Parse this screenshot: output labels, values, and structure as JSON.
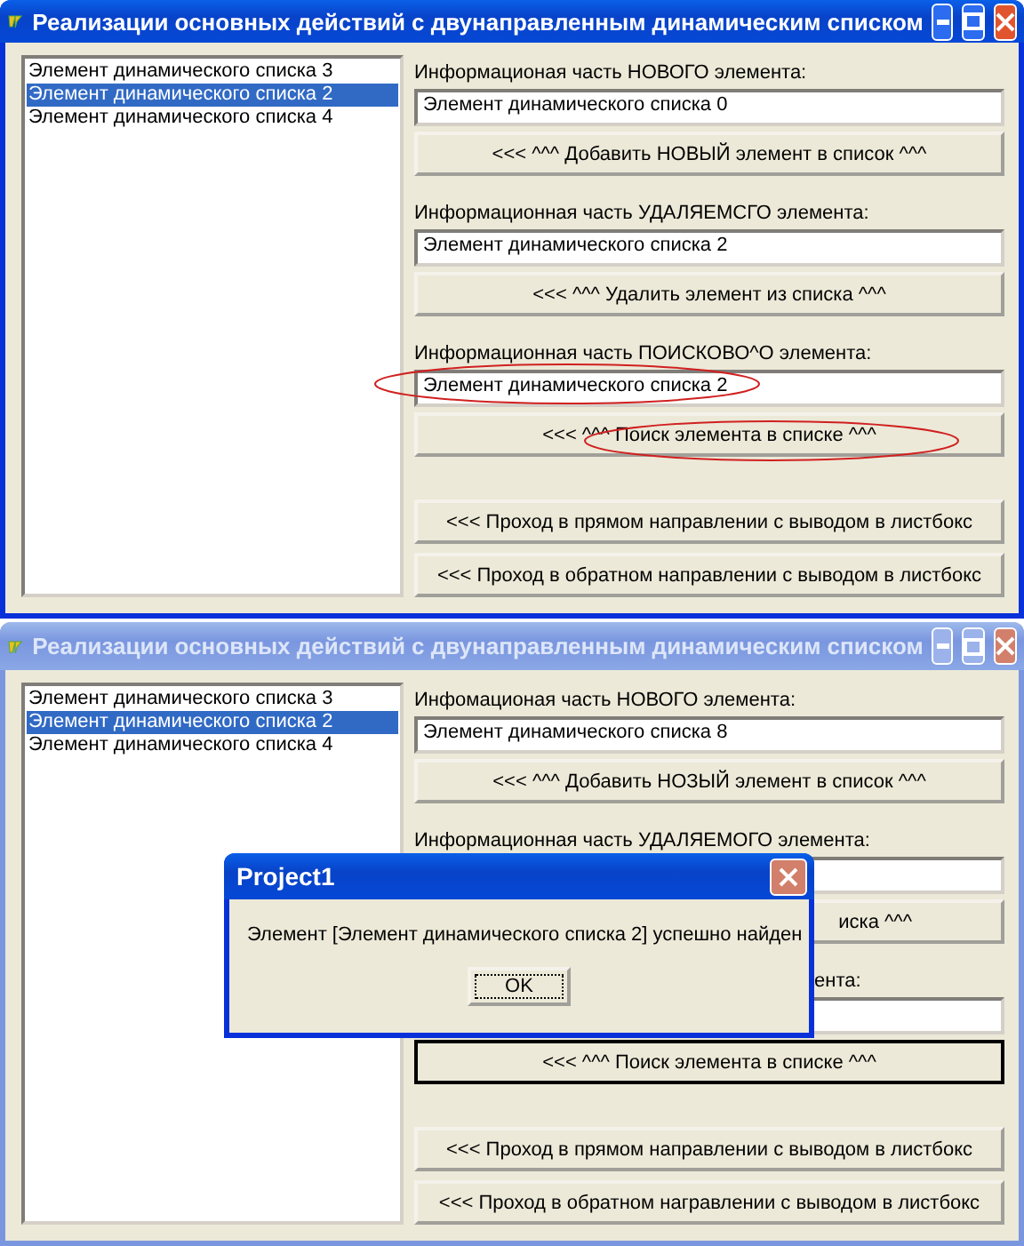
{
  "windows": [
    {
      "title": "Реализации основных действий с двунаправленным динамическим списком",
      "active": true,
      "list": [
        {
          "label": "Элемент динамического списка 3",
          "selected": false
        },
        {
          "label": "Элемент динамического списка 2",
          "selected": true
        },
        {
          "label": "Элемент динамического списка 4",
          "selected": false
        }
      ],
      "sections": [
        {
          "label": "Информационая часть НОВОГО элемента:",
          "value": "Элемент динамического списка 0",
          "button": "<<< ^^^ Добавить НОВЫЙ элемент в список ^^^",
          "label_covered": false,
          "button_covered": false,
          "highlighted": false,
          "focused": false
        },
        {
          "label": "Информационная часть УДАЛЯЕМСГО элемента:",
          "value": "Элемент динамического списка 2",
          "button": "<<< ^^^ Удалить элемент из списка ^^^",
          "label_covered": false,
          "button_covered": false,
          "highlighted": false,
          "focused": false
        },
        {
          "label": "Информационная часть ПОИСКОВО^О элемента:",
          "value": "Элемент динамического списка 2",
          "button": "<<< ^^^ Поиск элемента в списке ^^^",
          "label_covered": false,
          "button_covered": false,
          "highlighted": true,
          "focused": false
        }
      ],
      "traversal_buttons": [
        "<<< Проход в прямом направлении с выводом в листбокс",
        "<<< Проход в обратном направлении с выводом в листбокс"
      ]
    },
    {
      "title": "Реализации основных действий с двунаправленным динамическим списком",
      "active": false,
      "list": [
        {
          "label": "Элемент динамического списка 3",
          "selected": false
        },
        {
          "label": "Элемент динамического списка 2",
          "selected": true
        },
        {
          "label": "Элемент динамического списка 4",
          "selected": false
        }
      ],
      "sections": [
        {
          "label": "Инфомационая часть НОВОГО элемента:",
          "value": "Элемент динамического списка 8",
          "button": "<<< ^^^ Добавить НОЗЫЙ элемент в список ^^^",
          "label_covered": false,
          "button_covered": false,
          "highlighted": false,
          "focused": false
        },
        {
          "label": "Информационная часть УДАЛЯЕМОГО элемента:",
          "button": "иска ^^^",
          "label_covered": false,
          "button_covered": true,
          "highlighted": false,
          "focused": false
        },
        {
          "label": "ента:",
          "button": "<<< ^^^ Поиск элемента в списке ^^^",
          "label_covered": true,
          "button_covered": false,
          "highlighted": false,
          "focused": true
        }
      ],
      "traversal_buttons": [
        "<<< Проход в прямом направлении с выводом в листбокс",
        "<<< Проход в обратном награвлении с выводом в листбокс"
      ],
      "dialog": {
        "title": "Project1",
        "message": "Элемент [Элемент динамического списка 2] успешно найден",
        "button": "OK"
      }
    }
  ]
}
